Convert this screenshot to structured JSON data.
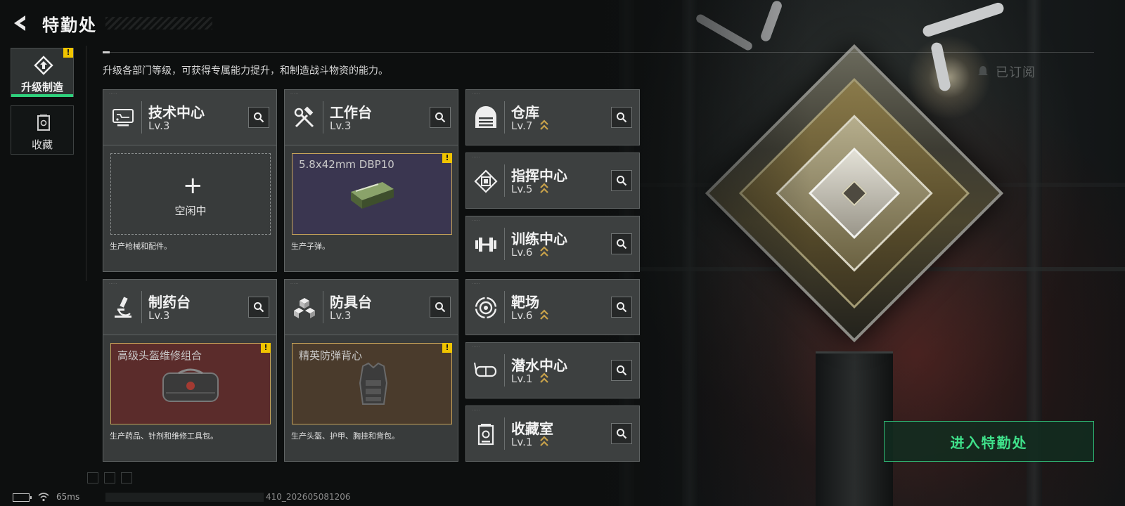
{
  "header": {
    "title": "特勤处",
    "intro": "升级各部门等级，可获得专属能力提升，和制造战斗物资的能力。",
    "subscribed_label": "已订阅"
  },
  "sidebar": {
    "items": [
      {
        "label": "升级制造",
        "icon": "upgrade-craft-icon",
        "active": true,
        "warning": "!"
      },
      {
        "label": "收藏",
        "icon": "collection-icon",
        "active": false
      }
    ]
  },
  "departments": {
    "tech_center": {
      "name": "技术中心",
      "level": "Lv.3",
      "icon": "tech-center-icon",
      "slot_state": "idle",
      "slot_plus": "+",
      "slot_idle_label": "空闲中",
      "desc": "生产枪械和配件。"
    },
    "workbench": {
      "name": "工作台",
      "level": "Lv.3",
      "icon": "wrench-hammer-icon",
      "slot_item": "5.8x42mm DBP10",
      "warning": "!",
      "desc": "生产子弹。"
    },
    "pharmacy": {
      "name": "制药台",
      "level": "Lv.3",
      "icon": "microscope-icon",
      "slot_item": "高级头盔维修组合",
      "warning": "!",
      "desc": "生产药品、针剂和维修工具包。"
    },
    "armor_bench": {
      "name": "防具台",
      "level": "Lv.3",
      "icon": "armor-blocks-icon",
      "slot_item": "精英防弹背心",
      "warning": "!",
      "desc": "生产头盔、护甲、胸挂和背包。"
    },
    "warehouse": {
      "name": "仓库",
      "level": "Lv.7",
      "icon": "warehouse-icon",
      "upgradable": true
    },
    "command_center": {
      "name": "指挥中心",
      "level": "Lv.5",
      "icon": "chip-icon",
      "upgradable": true
    },
    "training_center": {
      "name": "训练中心",
      "level": "Lv.6",
      "icon": "dumbbell-icon",
      "upgradable": true
    },
    "shooting_range": {
      "name": "靶场",
      "level": "Lv.6",
      "icon": "target-icon",
      "upgradable": true
    },
    "diving_center": {
      "name": "潜水中心",
      "level": "Lv.1",
      "icon": "diving-mask-icon",
      "upgradable": true
    },
    "collection_room": {
      "name": "收藏室",
      "level": "Lv.1",
      "icon": "collection-room-icon",
      "upgradable": true
    }
  },
  "cta": {
    "enter_label": "进入特勤处"
  },
  "status": {
    "ping": "65ms",
    "build_id": "410_202605081206"
  },
  "colors": {
    "accent_green": "#3fe08a",
    "warning_yellow": "#f0c400",
    "slot_border_gold": "#c7a45a",
    "pharmacy_slot_bg": "#5b2c2b",
    "armor_slot_bg": "#4a3b2c",
    "workbench_slot_bg": "#3a3650"
  }
}
